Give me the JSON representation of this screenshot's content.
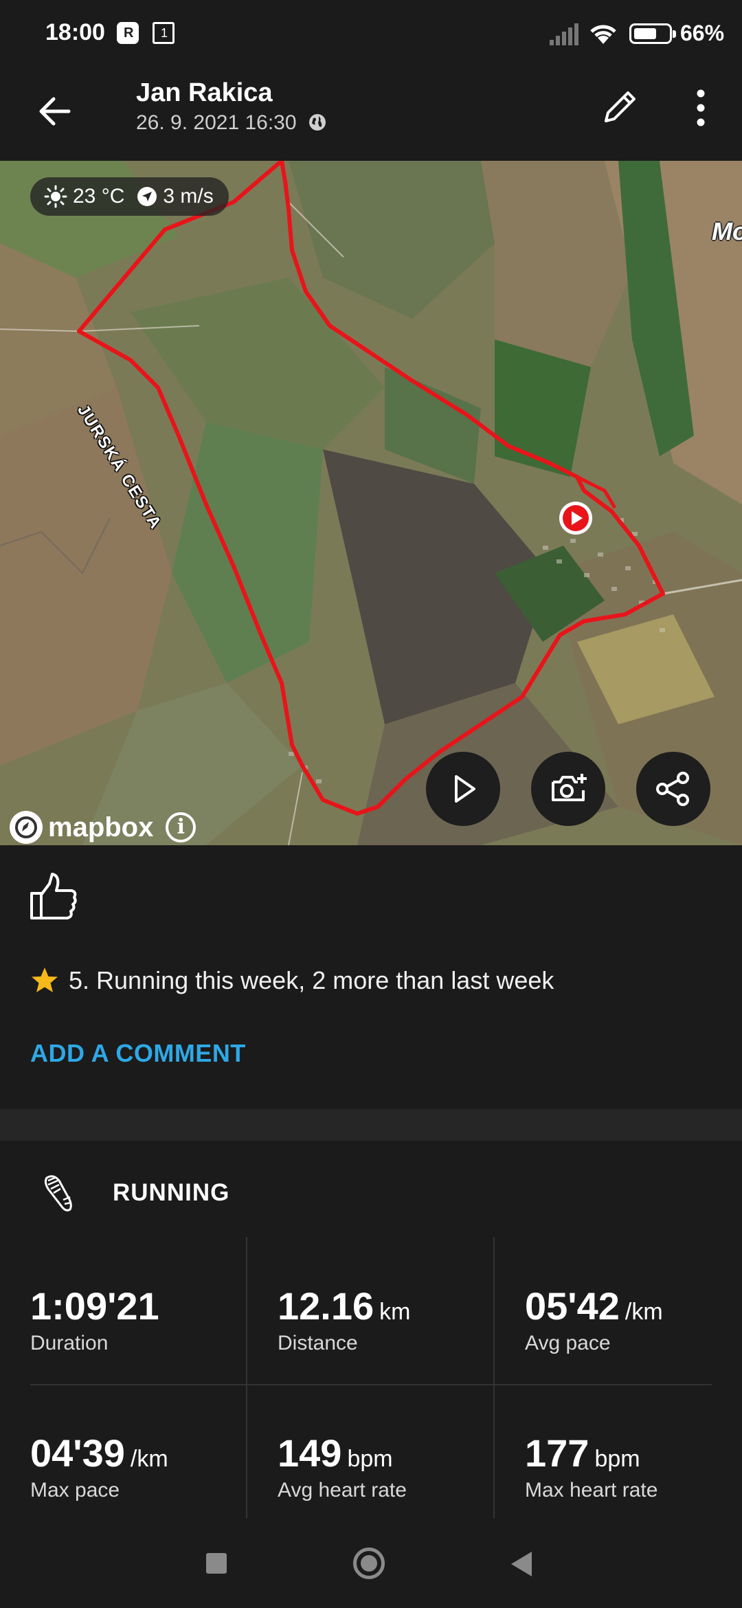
{
  "status_bar": {
    "time": "18:00",
    "battery": "66%",
    "battery_level": 0.66
  },
  "header": {
    "title": "Jan Rakica",
    "subtitle": "26. 9. 2021 16:30"
  },
  "map": {
    "weather_temp": "23 °C",
    "weather_wind": "3 m/s",
    "road_label": "JURSKÁ CESTA",
    "place_label": "Mo",
    "attribution": "mapbox",
    "route_color": "#e8141a"
  },
  "social": {
    "achievement": "5. Running this week, 2 more than last week",
    "add_comment": "ADD A COMMENT"
  },
  "activity": {
    "type": "RUNNING",
    "stats": [
      {
        "value": "1:09'21",
        "unit": "",
        "label": "Duration"
      },
      {
        "value": "12.16",
        "unit": "km",
        "label": "Distance"
      },
      {
        "value": "05'42",
        "unit": "/km",
        "label": "Avg pace"
      },
      {
        "value": "04'39",
        "unit": "/km",
        "label": "Max pace"
      },
      {
        "value": "149",
        "unit": "bpm",
        "label": "Avg heart rate"
      },
      {
        "value": "177",
        "unit": "bpm",
        "label": "Max heart rate"
      }
    ]
  }
}
